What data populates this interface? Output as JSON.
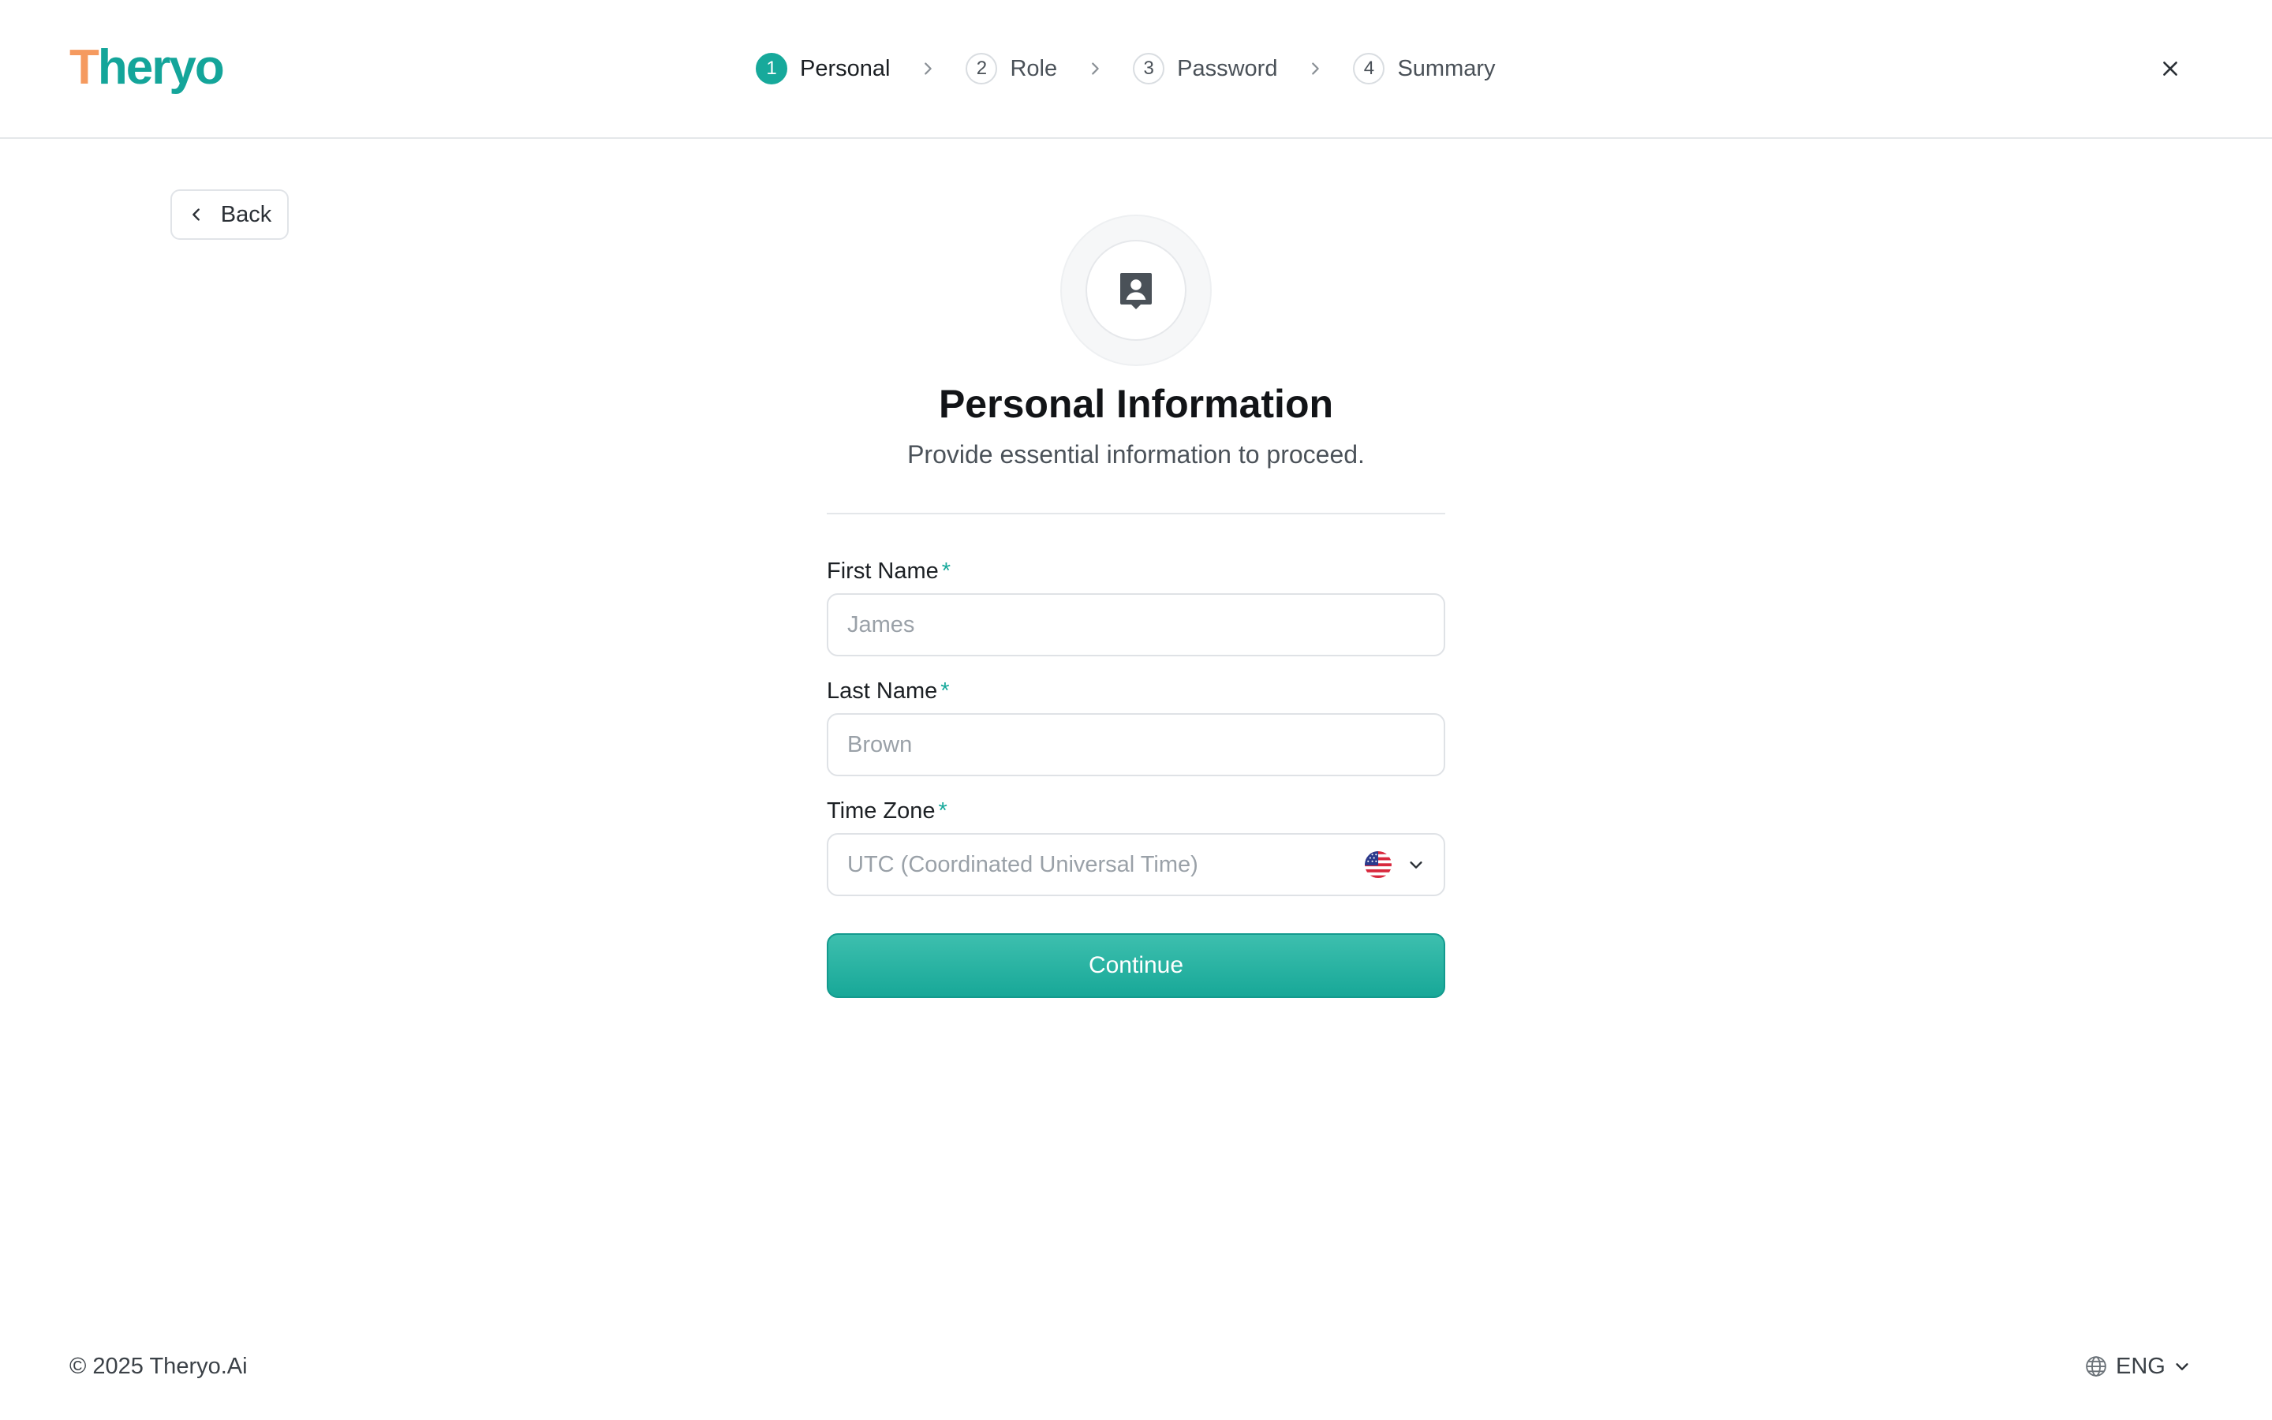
{
  "brand": {
    "logo_first": "T",
    "logo_rest": "heryo"
  },
  "stepper": {
    "steps": [
      {
        "number": "1",
        "label": "Personal"
      },
      {
        "number": "2",
        "label": "Role"
      },
      {
        "number": "3",
        "label": "Password"
      },
      {
        "number": "4",
        "label": "Summary"
      }
    ],
    "active_step": 1
  },
  "back_label": "Back",
  "hero": {
    "icon": "contact-card-icon",
    "title": "Personal Information",
    "subtitle": "Provide essential information to proceed."
  },
  "form": {
    "first_name": {
      "label": "First Name",
      "required_mark": "*",
      "placeholder": "James",
      "value": ""
    },
    "last_name": {
      "label": "Last Name",
      "required_mark": "*",
      "placeholder": "Brown",
      "value": ""
    },
    "time_zone": {
      "label": "Time Zone",
      "required_mark": "*",
      "value": "UTC (Coordinated Universal Time)",
      "flag_icon": "us-flag-icon"
    },
    "continue_label": "Continue"
  },
  "footer": {
    "copyright": "© 2025 Theryo.Ai",
    "language": "ENG"
  },
  "colors": {
    "accent": "#17a99b",
    "logo_t": "#f59a5f"
  }
}
